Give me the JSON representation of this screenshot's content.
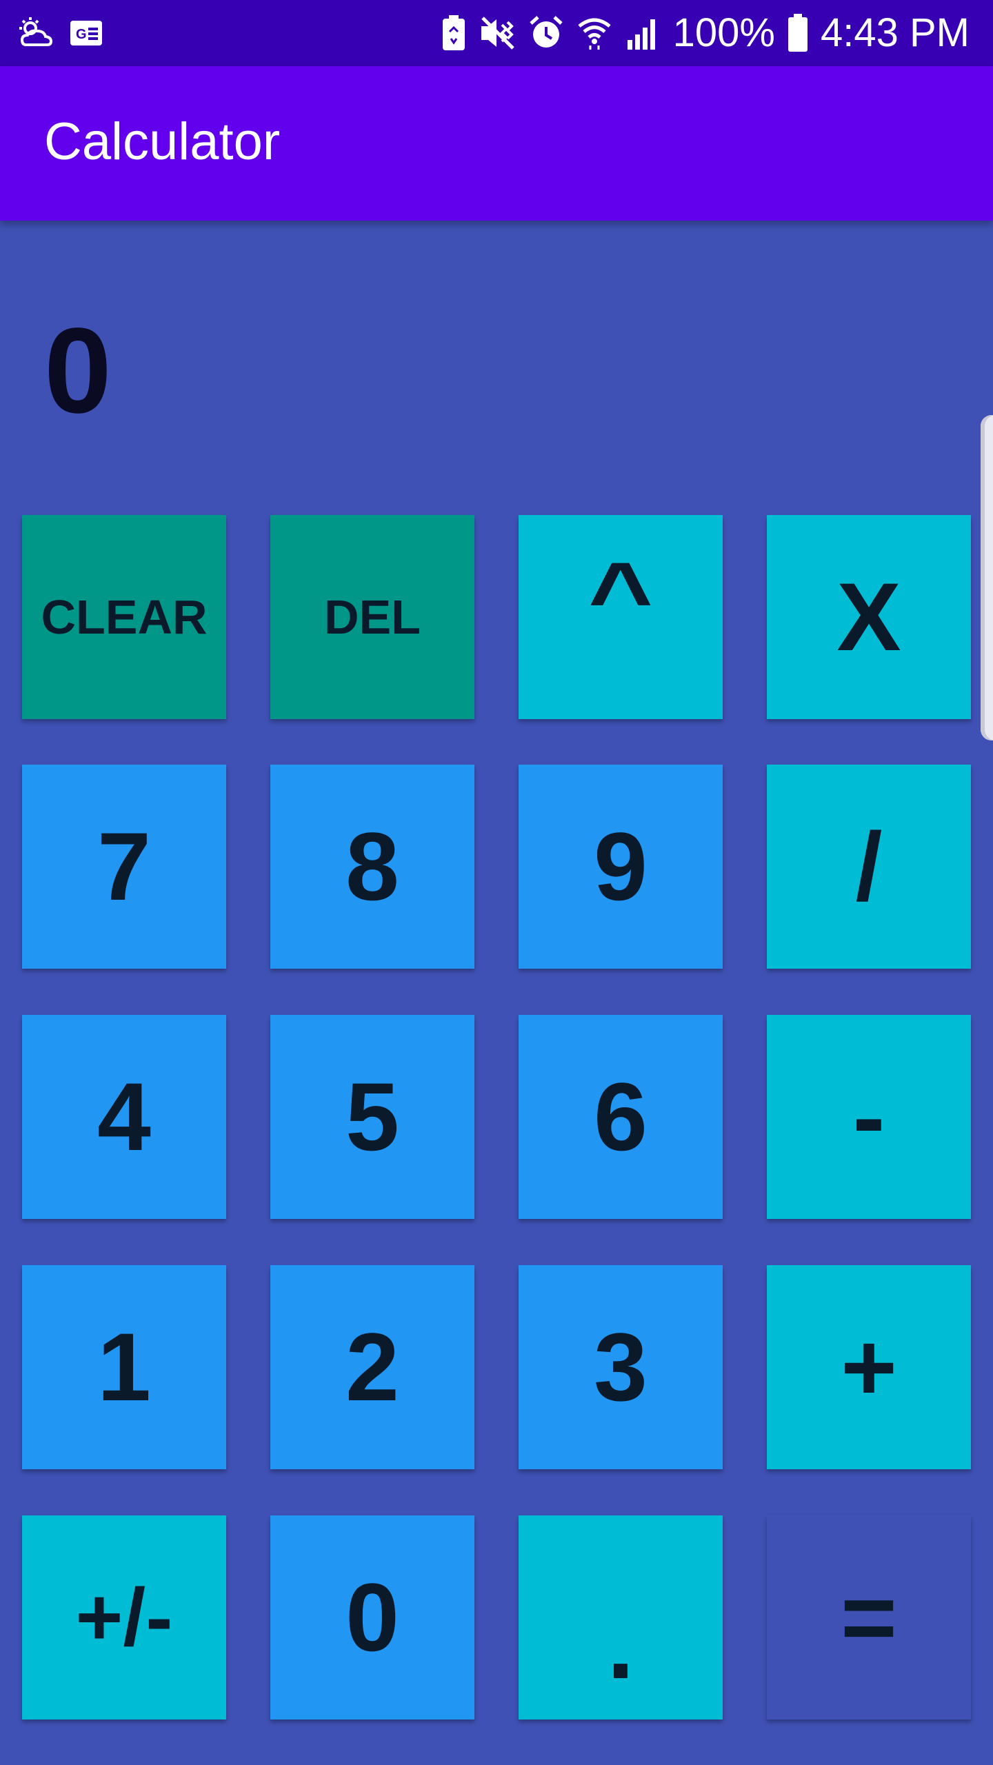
{
  "status_bar": {
    "battery_percent": "100%",
    "time": "4:43 PM",
    "icons": [
      "weather-icon",
      "news-icon",
      "battery-saver-icon",
      "mute-vibrate-icon",
      "alarm-icon",
      "wifi-icon",
      "signal-icon",
      "battery-icon"
    ]
  },
  "app_bar": {
    "title": "Calculator"
  },
  "display": {
    "value": "0"
  },
  "keypad": {
    "clear": "CLEAR",
    "del": "DEL",
    "power": "^",
    "multiply": "X",
    "seven": "7",
    "eight": "8",
    "nine": "9",
    "divide": "/",
    "four": "4",
    "five": "5",
    "six": "6",
    "minus": "-",
    "one": "1",
    "two": "2",
    "three": "3",
    "plus": "+",
    "sign": "+/-",
    "zero": "0",
    "decimal": ".",
    "equals": "="
  },
  "colors": {
    "status_bar": "#3700b3",
    "app_bar": "#6200ee",
    "background": "#3f51b5",
    "function_key": "#009688",
    "operator_key": "#00bcd4",
    "digit_key": "#2196f3"
  }
}
